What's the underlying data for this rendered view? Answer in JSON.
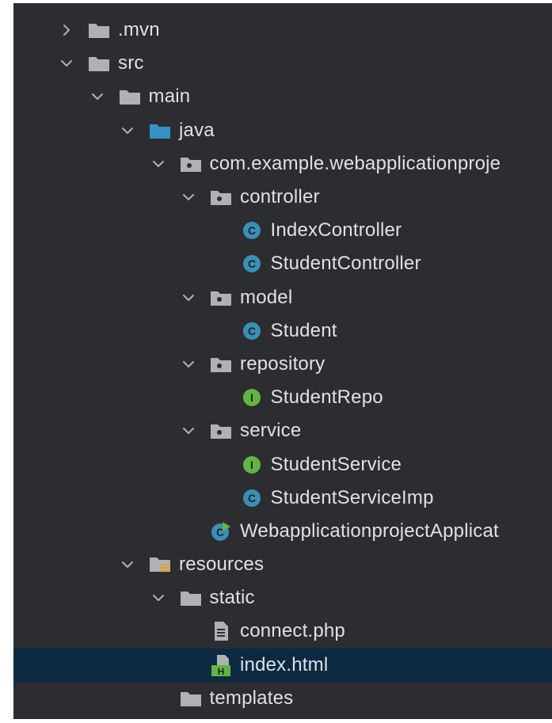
{
  "tree": [
    {
      "label": ".mvn",
      "icon": "folder-icon",
      "state": "collapsed",
      "level": 0
    },
    {
      "label": "src",
      "icon": "folder-icon",
      "state": "expanded",
      "level": 0
    },
    {
      "label": "main",
      "icon": "folder-icon",
      "state": "expanded",
      "level": 1
    },
    {
      "label": "java",
      "icon": "source-folder-icon",
      "state": "expanded",
      "level": 2
    },
    {
      "label": "com.example.webapplicationproje",
      "icon": "package-icon",
      "state": "expanded",
      "level": 3
    },
    {
      "label": "controller",
      "icon": "package-icon",
      "state": "expanded",
      "level": 4
    },
    {
      "label": "IndexController",
      "icon": "class-icon",
      "state": "leaf",
      "level": 5
    },
    {
      "label": "StudentController",
      "icon": "class-icon",
      "state": "leaf",
      "level": 5
    },
    {
      "label": "model",
      "icon": "package-icon",
      "state": "expanded",
      "level": 4
    },
    {
      "label": "Student",
      "icon": "class-icon",
      "state": "leaf",
      "level": 5
    },
    {
      "label": "repository",
      "icon": "package-icon",
      "state": "expanded",
      "level": 4
    },
    {
      "label": "StudentRepo",
      "icon": "interface-icon",
      "state": "leaf",
      "level": 5
    },
    {
      "label": "service",
      "icon": "package-icon",
      "state": "expanded",
      "level": 4
    },
    {
      "label": "StudentService",
      "icon": "interface-icon",
      "state": "leaf",
      "level": 5
    },
    {
      "label": "StudentServiceImp",
      "icon": "class-icon",
      "state": "leaf",
      "level": 5
    },
    {
      "label": "WebapplicationprojectApplicat",
      "icon": "spring-boot-class-icon",
      "state": "leaf",
      "level": 4
    },
    {
      "label": "resources",
      "icon": "resources-folder-icon",
      "state": "expanded",
      "level": 2
    },
    {
      "label": "static",
      "icon": "folder-icon",
      "state": "expanded",
      "level": 3
    },
    {
      "label": "connect.php",
      "icon": "text-file-icon",
      "state": "leaf",
      "level": 4
    },
    {
      "label": "index.html",
      "icon": "html-file-icon",
      "state": "leaf",
      "level": 4,
      "selected": true
    },
    {
      "label": "templates",
      "icon": "folder-icon",
      "state": "leaf-folder",
      "level": 3
    }
  ],
  "colors": {
    "background": "#2b2d30",
    "text": "#dfe1e5",
    "selection": "#0d2a43",
    "folder": "#afb1b3",
    "source_folder": "#3592c4",
    "class": "#3a8fb7",
    "interface": "#62b543",
    "chevron": "#afb1b3"
  },
  "icon_letters": {
    "class": "C",
    "interface": "I",
    "html_file": "H"
  }
}
